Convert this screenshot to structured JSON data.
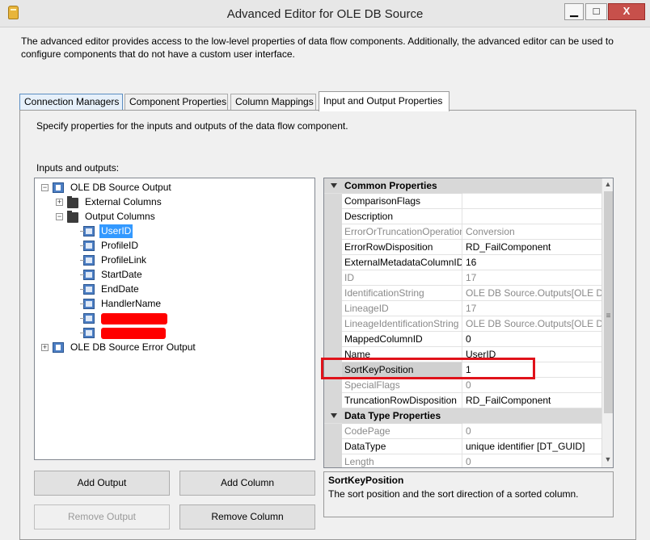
{
  "window": {
    "title": "Advanced Editor for OLE DB Source",
    "min_label": "▁",
    "max_label": "□",
    "close_label": "X"
  },
  "description": "The advanced editor provides access to the low-level properties of data flow components. Additionally, the advanced editor can be used to configure components that do not have a custom user interface.",
  "tabs": [
    {
      "label": "Connection Managers"
    },
    {
      "label": "Component Properties"
    },
    {
      "label": "Column Mappings"
    },
    {
      "label": "Input and Output Properties",
      "active": true
    }
  ],
  "panel": {
    "description": "Specify properties for the inputs and outputs of the data flow component.",
    "io_label": "Inputs and outputs:"
  },
  "tree": {
    "output": "OLE DB Source Output",
    "external_columns": "External Columns",
    "output_columns": "Output Columns",
    "columns": [
      "UserID",
      "ProfileID",
      "ProfileLink",
      "StartDate",
      "EndDate",
      "HandlerName"
    ],
    "selected": "UserID",
    "error_output": "OLE DB Source Error Output",
    "expand_minus": "−",
    "expand_plus": "+"
  },
  "properties": {
    "common_header": "Common Properties",
    "datatype_header": "Data Type Properties",
    "rows": [
      {
        "name": "ComparisonFlags",
        "value": ""
      },
      {
        "name": "Description",
        "value": ""
      },
      {
        "name": "ErrorOrTruncationOperation",
        "value": "Conversion",
        "readonly": true
      },
      {
        "name": "ErrorRowDisposition",
        "value": "RD_FailComponent"
      },
      {
        "name": "ExternalMetadataColumnID",
        "value": "16"
      },
      {
        "name": "ID",
        "value": "17",
        "readonly": true
      },
      {
        "name": "IdentificationString",
        "value": "OLE DB Source.Outputs[OLE DB",
        "readonly": true
      },
      {
        "name": "LineageID",
        "value": "17",
        "readonly": true
      },
      {
        "name": "LineageIdentificationString",
        "value": "OLE DB Source.Outputs[OLE DB",
        "readonly": true
      },
      {
        "name": "MappedColumnID",
        "value": "0"
      },
      {
        "name": "Name",
        "value": "UserID"
      },
      {
        "name": "SortKeyPosition",
        "value": "1",
        "selected": true
      },
      {
        "name": "SpecialFlags",
        "value": "0",
        "readonly": true
      },
      {
        "name": "TruncationRowDisposition",
        "value": "RD_FailComponent"
      }
    ],
    "datatype_rows": [
      {
        "name": "CodePage",
        "value": "0",
        "readonly": true
      },
      {
        "name": "DataType",
        "value": "unique identifier [DT_GUID]"
      },
      {
        "name": "Length",
        "value": "0",
        "readonly": true
      }
    ],
    "scroll_up": "▲",
    "scroll_down": "▼",
    "scroll_grip": "≡"
  },
  "help": {
    "title": "SortKeyPosition",
    "text": "The sort position and the sort direction of a sorted column."
  },
  "buttons": {
    "add_output": "Add Output",
    "add_column": "Add Column",
    "remove_output": "Remove Output",
    "remove_column": "Remove Column"
  },
  "colors": {
    "selection": "#3399ff",
    "highlight_box": "#e0121a",
    "redaction": "#ff0000"
  }
}
